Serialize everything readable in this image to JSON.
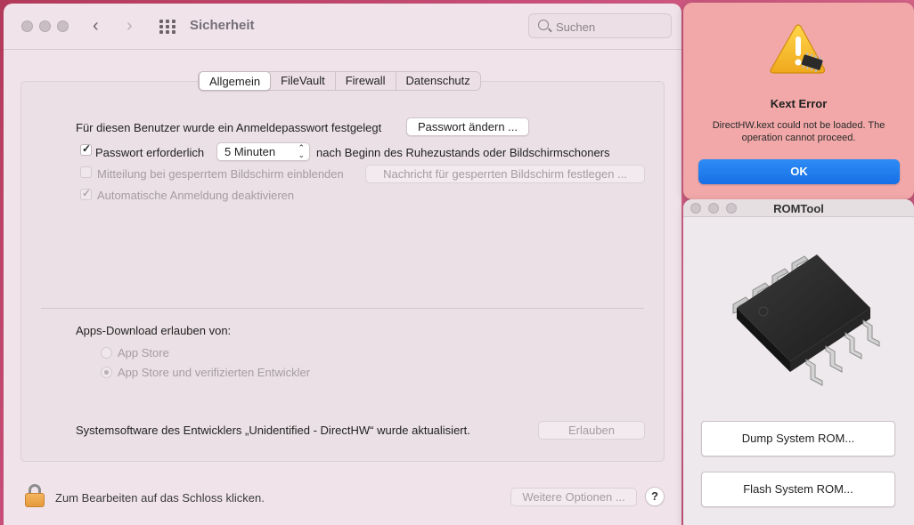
{
  "window": {
    "title": "Sicherheit",
    "search_placeholder": "Suchen"
  },
  "tabs": [
    "Allgemein",
    "FileVault",
    "Firewall",
    "Datenschutz"
  ],
  "active_tab": "Allgemein",
  "general": {
    "password_set_text": "Für diesen Benutzer wurde ein Anmeldepasswort festgelegt",
    "change_password_button": "Passwort ändern ...",
    "require_password_label": "Passwort erforderlich",
    "require_password_checked": true,
    "require_password_delay": "5 Minuten",
    "require_password_suffix": "nach Beginn des Ruhezustands oder Bildschirmschoners",
    "show_message_label": "Mitteilung bei gesperrtem Bildschirm einblenden",
    "show_message_checked": false,
    "set_message_button": "Nachricht für gesperrten Bildschirm festlegen ...",
    "disable_autologin_label": "Automatische Anmeldung deaktivieren",
    "disable_autologin_checked": true
  },
  "downloads": {
    "heading": "Apps-Download erlauben von:",
    "options": [
      "App Store",
      "App Store und verifizierten Entwickler"
    ],
    "selected": "App Store und verifizierten Entwickler"
  },
  "system_software": {
    "text": "Systemsoftware des Entwicklers „Unidentified - DirectHW“ wurde aktualisiert.",
    "allow_button": "Erlauben"
  },
  "footer": {
    "lock_text": "Zum Bearbeiten auf das Schloss klicken.",
    "more_options_button": "Weitere Optionen ...",
    "help_label": "?"
  },
  "alert": {
    "title": "Kext Error",
    "message": "DirectHW.kext could not be loaded. The operation cannot proceed.",
    "ok_button": "OK",
    "icon": "warning-chip-icon"
  },
  "romtool": {
    "title": "ROMTool",
    "dump_button": "Dump System ROM...",
    "flash_button": "Flash System ROM...",
    "image": "soic8-chip"
  },
  "colors": {
    "accent": "#1670e6",
    "alert_bg": "#f2a8a8",
    "window_bg": "#f0e4ea",
    "lock": "#e59a3a"
  }
}
